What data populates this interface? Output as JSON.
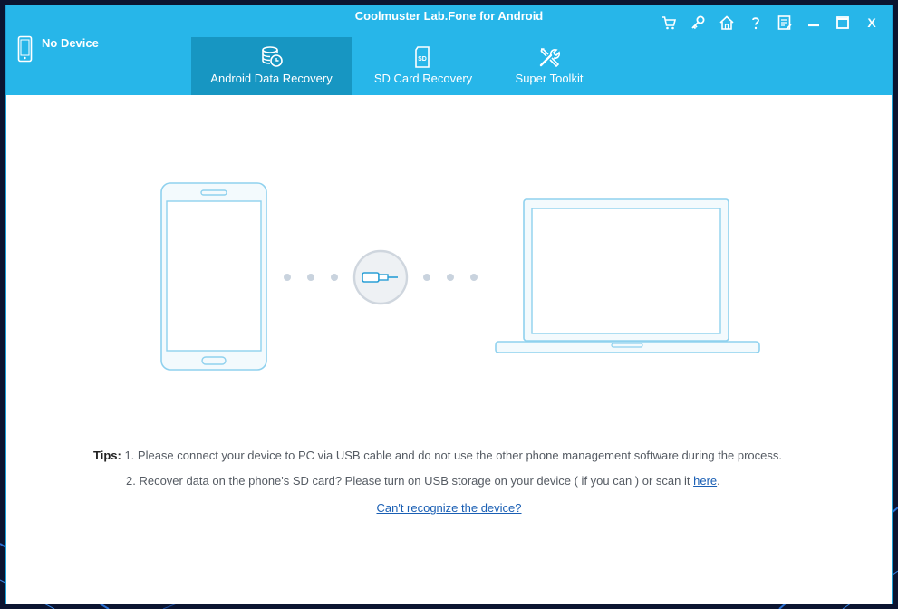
{
  "window": {
    "title": "Coolmuster Lab.Fone for Android"
  },
  "device": {
    "status": "No Device"
  },
  "tabs": [
    {
      "label": "Android Data Recovery",
      "icon": "database-restore-icon",
      "active": true
    },
    {
      "label": "SD Card Recovery",
      "icon": "sd-card-icon",
      "active": false
    },
    {
      "label": "Super Toolkit",
      "icon": "tools-icon",
      "active": false
    }
  ],
  "toolbar_icons": [
    "cart-icon",
    "key-icon",
    "home-icon",
    "help-icon",
    "feedback-icon",
    "minimize-icon",
    "maximize-icon",
    "close-icon"
  ],
  "close_label": "X",
  "tips": {
    "label": "Tips:",
    "line1": "1. Please connect your device to PC via USB cable and do not use the other phone management software during the process.",
    "line2_text": "2. Recover data on the phone's SD card? Please turn on USB storage on your device ( if you can ) or scan it ",
    "line2_link": "here",
    "line2_end": "."
  },
  "help_link": "Can't recognize the device?",
  "colors": {
    "accent": "#27b6e9",
    "active_tab": "#1796c2",
    "illustration_stroke": "#8fd1ee",
    "illustration_fill": "#e6f5fc",
    "link": "#1a5fb4"
  }
}
